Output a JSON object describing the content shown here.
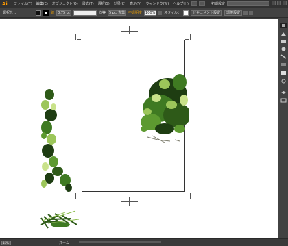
{
  "app": {
    "logo": "Ai"
  },
  "menubar": {
    "items": [
      "ファイル(F)",
      "編集(E)",
      "オブジェクト(O)",
      "書式(T)",
      "選択(S)",
      "効果(C)",
      "表示(V)",
      "ウィンドウ(W)",
      "ヘルプ(H)"
    ],
    "workspace": "初期設定"
  },
  "control": {
    "selection": "選択なし",
    "stroke_label": "線",
    "stroke_weight": "0.75 pt",
    "stroke_style": "均等",
    "brush": "5 pt. 丸筆",
    "opacity_label": "不透明度",
    "opacity": "100%",
    "style_label": "スタイル：",
    "doc_setup": "ドキュメント設定",
    "prefs": "環境設定"
  },
  "status": {
    "zoom": "15%",
    "text": "ズーム"
  },
  "colors": {
    "leaf_dark": "#1e3d12",
    "leaf_mid": "#3f7a22",
    "leaf_light": "#9cc65a",
    "accent": "#f0a000"
  },
  "tools": [
    "panel-color-icon",
    "panel-swatches-icon",
    "panel-brushes-icon",
    "panel-symbols-icon",
    "panel-stroke-icon",
    "panel-gradient-icon",
    "panel-transparency-icon",
    "panel-appearance-icon",
    "panel-layers-icon",
    "panel-artboards-icon"
  ]
}
